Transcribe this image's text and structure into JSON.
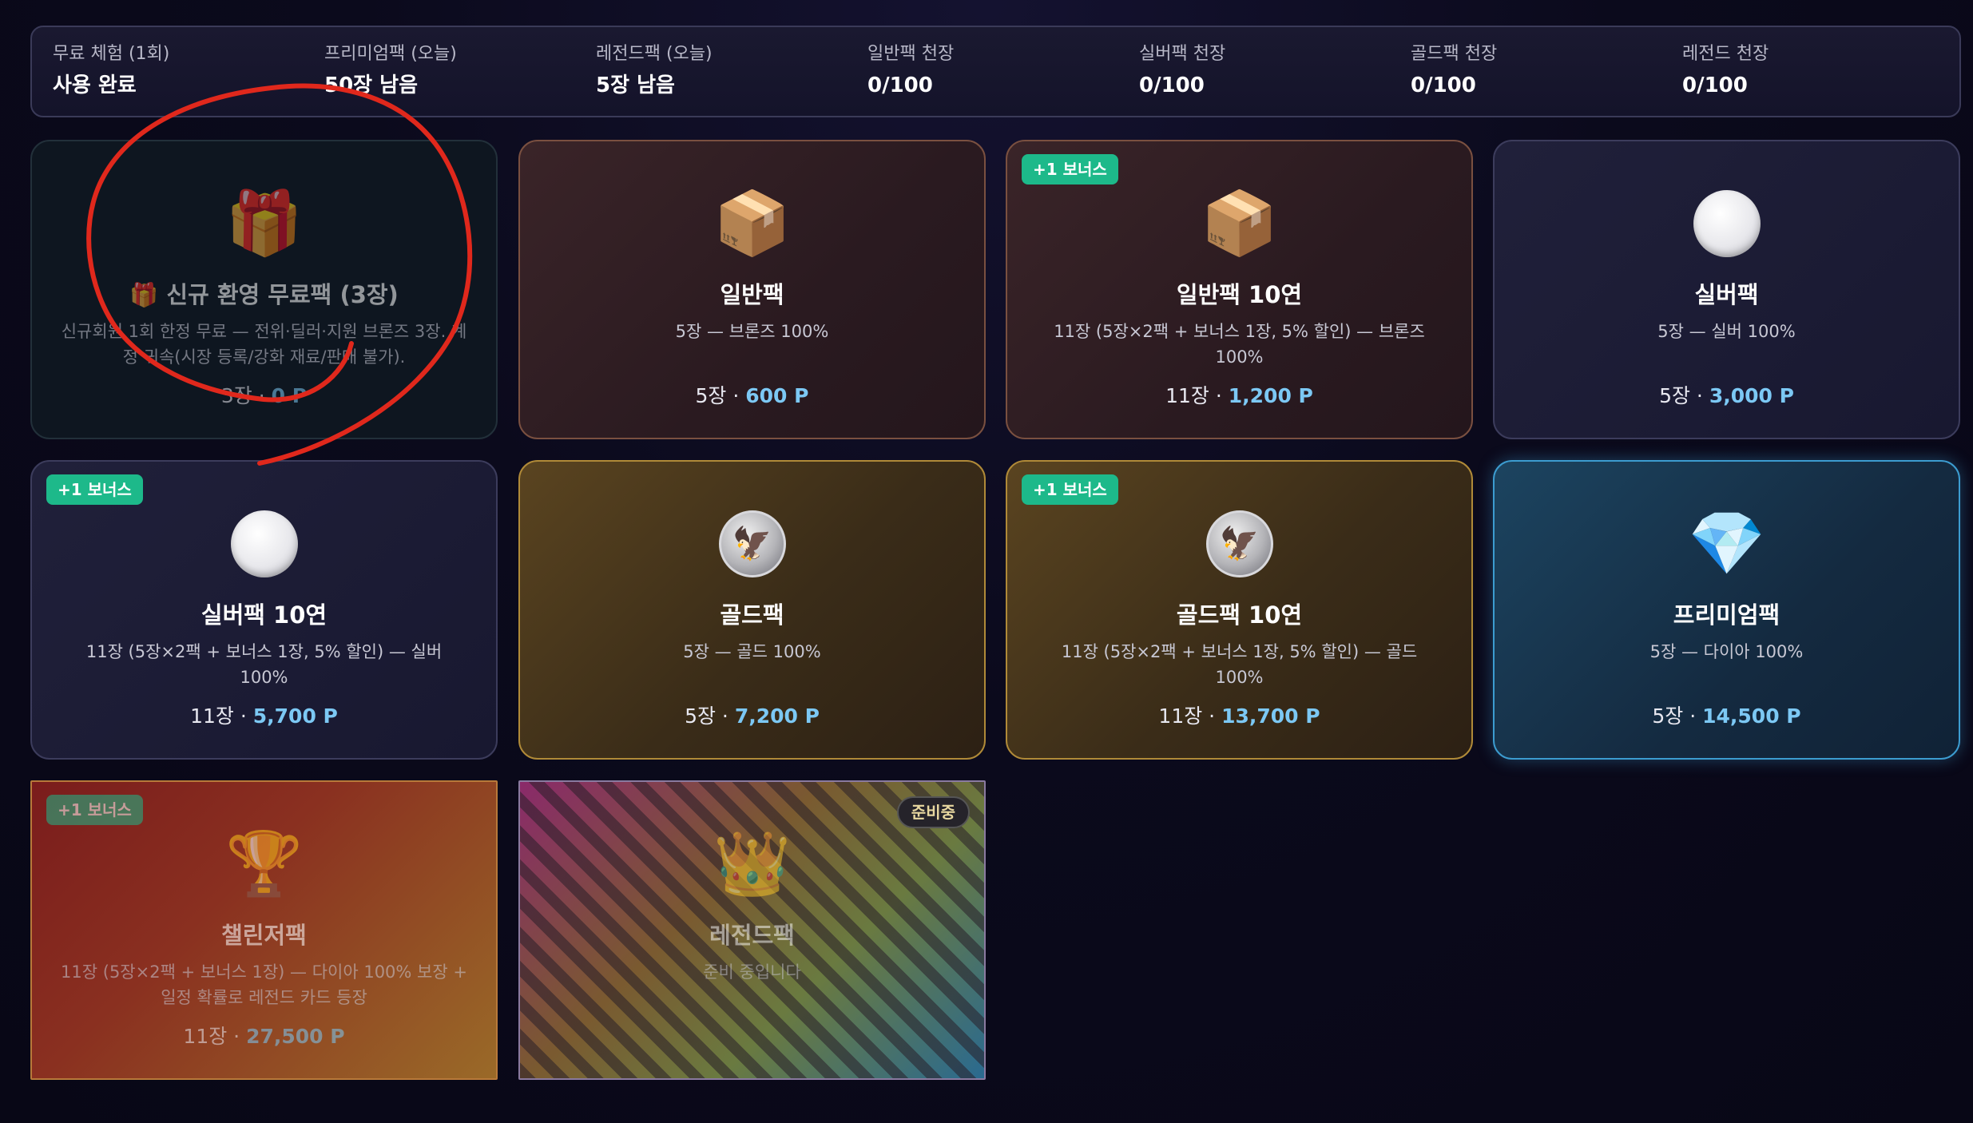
{
  "stats": [
    {
      "label": "무료 체험 (1회)",
      "value": "사용 완료"
    },
    {
      "label": "프리미엄팩 (오늘)",
      "value": "50장 남음"
    },
    {
      "label": "레전드팩 (오늘)",
      "value": "5장 남음"
    },
    {
      "label": "일반팩 천장",
      "value": "0/100"
    },
    {
      "label": "실버팩 천장",
      "value": "0/100"
    },
    {
      "label": "골드팩 천장",
      "value": "0/100"
    },
    {
      "label": "레전드 천장",
      "value": "0/100"
    }
  ],
  "packs": [
    {
      "icon": "gift-icon",
      "glyph": "🎁",
      "name": "🎁 신규 환영 무료팩 (3장)",
      "desc": "신규회원 1회 한정 무료 — 전위·딜러·지원 브론즈 3장. 계정 귀속(시장 등록/강화 재료/판매 불가).",
      "count": "3장 · ",
      "points": "0 P"
    },
    {
      "icon": "box-icon",
      "glyph": "📦",
      "name": "일반팩",
      "desc": "5장 — 브론즈 100%",
      "count": "5장 · ",
      "points": "600 P"
    },
    {
      "icon": "box-icon",
      "glyph": "📦",
      "badge": "+1 보너스",
      "name": "일반팩 10연",
      "desc": "11장 (5장×2팩 + 보너스 1장, 5% 할인) — 브론즈 100%",
      "count": "11장 · ",
      "points": "1,200 P"
    },
    {
      "icon": "silver-coin-icon",
      "name": "실버팩",
      "desc": "5장 — 실버 100%",
      "count": "5장 · ",
      "points": "3,000 P"
    },
    {
      "icon": "silver-coin-icon",
      "badge": "+1 보너스",
      "name": "실버팩 10연",
      "desc": "11장 (5장×2팩 + 보너스 1장, 5% 할인) — 실버 100%",
      "count": "11장 · ",
      "points": "5,700 P"
    },
    {
      "icon": "eagle-coin-icon",
      "name": "골드팩",
      "desc": "5장 — 골드 100%",
      "count": "5장 · ",
      "points": "7,200 P"
    },
    {
      "icon": "eagle-coin-icon",
      "badge": "+1 보너스",
      "name": "골드팩 10연",
      "desc": "11장 (5장×2팩 + 보너스 1장, 5% 할인) — 골드 100%",
      "count": "11장 · ",
      "points": "13,700 P"
    },
    {
      "icon": "diamond-icon",
      "glyph": "💎",
      "name": "프리미엄팩",
      "desc": "5장 — 다이아 100%",
      "count": "5장 · ",
      "points": "14,500 P"
    },
    {
      "icon": "trophy-icon",
      "glyph": "🏆",
      "badge": "+1 보너스",
      "name": "챌린저팩",
      "desc": "11장 (5장×2팩 + 보너스 1장) — 다이아 100% 보장 + 일정 확률로 레전드 카드 등장",
      "count": "11장 · ",
      "points": "27,500 P"
    },
    {
      "icon": "crown-icon",
      "glyph": "👑",
      "badge_soon": "준비중",
      "name": "레전드팩",
      "desc": "준비 중입니다"
    }
  ],
  "colors": {
    "accent_points": "#7cc8f4",
    "bonus_badge": "#1db98a",
    "annotation": "#e0281c"
  }
}
